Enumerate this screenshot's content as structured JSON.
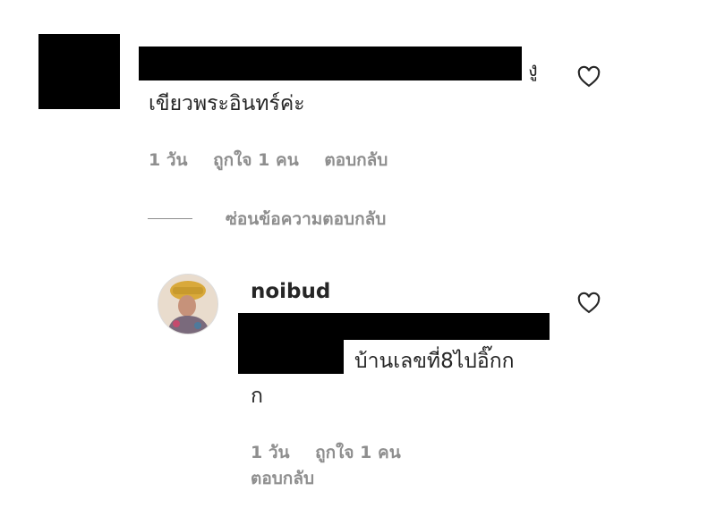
{
  "comment1": {
    "text_tail": "งู",
    "text_line2": "เขียวพระอินทร์ค่ะ",
    "time": "1 วัน",
    "likes": "ถูกใจ 1 คน",
    "reply": "ตอบกลับ"
  },
  "hide_replies": "ซ่อนข้อความตอบกลับ",
  "comment2": {
    "username": "noibud",
    "text_line1": "บ้านเลขที่8ไปอิ๊กก",
    "text_line2": "ก",
    "time": "1 วัน",
    "likes": "ถูกใจ 1 คน",
    "reply": "ตอบกลับ"
  },
  "icons": {
    "like": "heart-outline-icon"
  },
  "colors": {
    "text_primary": "#262626",
    "text_secondary": "#8e8e8e",
    "redaction": "#000000"
  }
}
